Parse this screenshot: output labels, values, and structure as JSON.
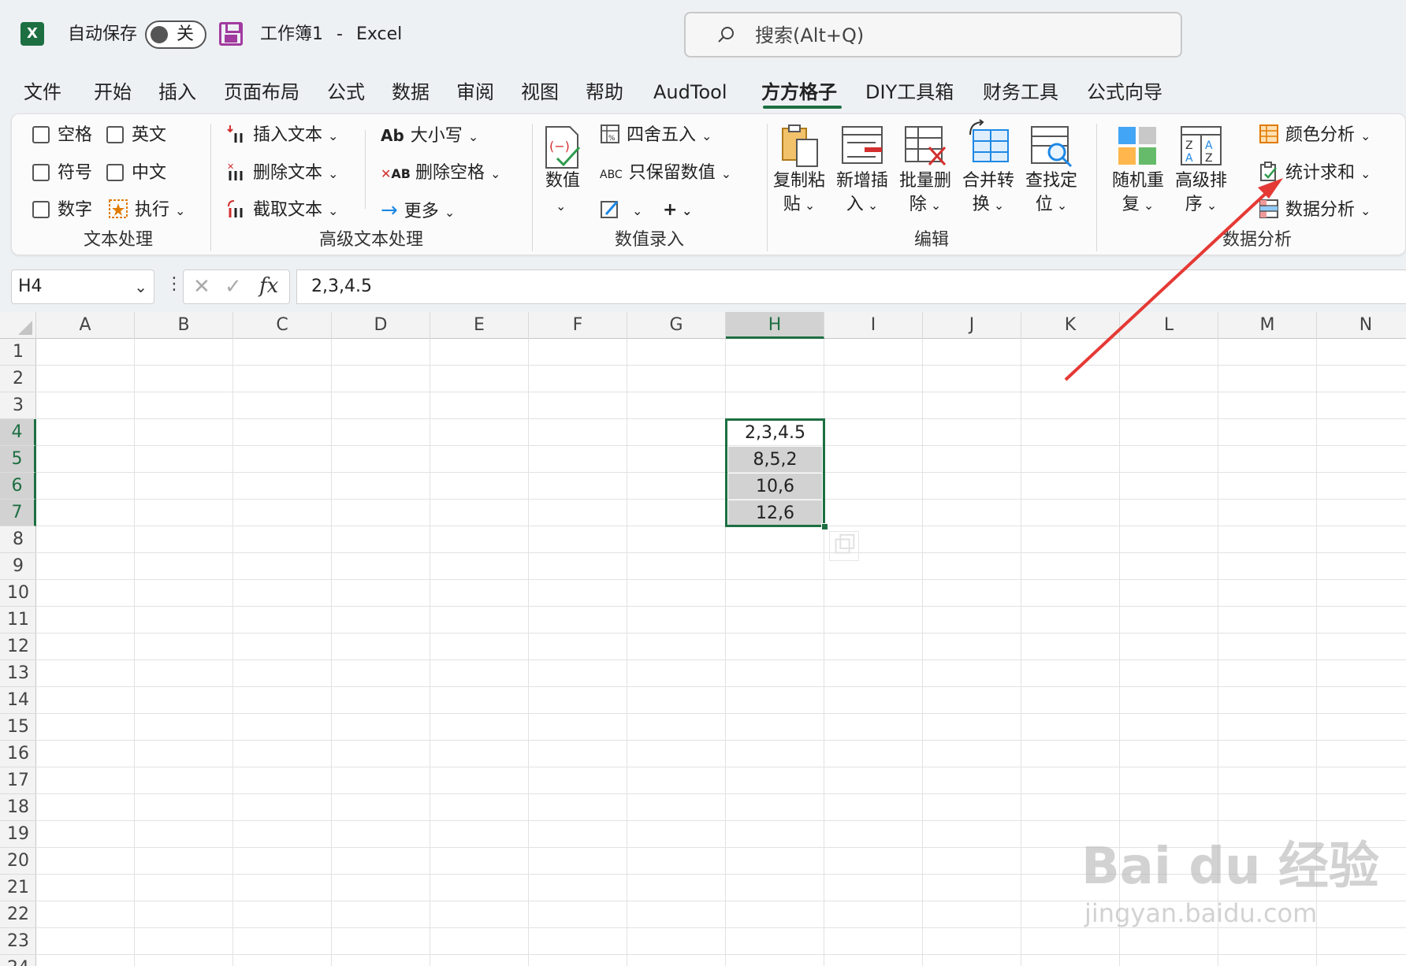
{
  "titlebar": {
    "app_logo": "X",
    "autosave_label": "自动保存",
    "autosave_state": "关",
    "doc_name": "工作簿1",
    "separator": "-",
    "app_name": "Excel",
    "search_placeholder": "搜索(Alt+Q)"
  },
  "menu": {
    "items": [
      "文件",
      "开始",
      "插入",
      "页面布局",
      "公式",
      "数据",
      "审阅",
      "视图",
      "帮助",
      "AudTool",
      "方方格子",
      "DIY工具箱",
      "财务工具",
      "公式向导"
    ],
    "active": "方方格子"
  },
  "ribbon": {
    "text_group": {
      "checkboxes": [
        "空格",
        "英文",
        "符号",
        "中文",
        "数字"
      ],
      "execute": "执行",
      "label": "文本处理"
    },
    "advanced_group": {
      "insert_text": "插入文本",
      "delete_text": "删除文本",
      "extract_text": "截取文本",
      "case": "大小写",
      "case_icon_text": "Ab",
      "delete_spaces": "删除空格",
      "delete_spaces_icon_text": "AB",
      "more": "更多",
      "label": "高级文本处理"
    },
    "number_group": {
      "value": "数值",
      "round": "四舍五入",
      "keep_values": "只保留数值",
      "keep_values_icon_text": "ABC",
      "plus": "+",
      "label": "数值录入"
    },
    "edit_group": {
      "buttons": [
        [
          "复制粘",
          "贴"
        ],
        [
          "新增插",
          "入"
        ],
        [
          "批量删",
          "除"
        ],
        [
          "合并转",
          "换"
        ],
        [
          "查找定",
          "位"
        ]
      ],
      "label": "编辑"
    },
    "analysis_group": {
      "random_repeat": [
        "随机重",
        "复"
      ],
      "advanced_sort": [
        "高级排",
        "序"
      ],
      "color_analysis": "颜色分析",
      "stat_sum": "统计求和",
      "data_analysis": "数据分析",
      "label": "数据分析"
    }
  },
  "formula_bar": {
    "cell_ref": "H4",
    "cancel": "✕",
    "enter": "✓",
    "fx": "fx",
    "value": "2,3,4.5"
  },
  "grid": {
    "columns": [
      "A",
      "B",
      "C",
      "D",
      "E",
      "F",
      "G",
      "H",
      "I",
      "J",
      "K",
      "L",
      "M",
      "N"
    ],
    "rows": [
      "1",
      "2",
      "3",
      "4",
      "5",
      "6",
      "7",
      "8",
      "9",
      "10",
      "11",
      "12",
      "13",
      "14",
      "15",
      "16",
      "17",
      "18",
      "19",
      "20",
      "21",
      "22",
      "23",
      "24"
    ],
    "selected_column": "H",
    "selected_rows": [
      "4",
      "5",
      "6",
      "7"
    ],
    "cells": {
      "H4": "2,3,4.5",
      "H5": "8,5,2",
      "H6": "10,6",
      "H7": "12,6"
    }
  },
  "watermark": {
    "brand": "Bai du 经验",
    "url": "jingyan.baidu.com"
  },
  "colors": {
    "excel_green": "#1d6f42",
    "arrow_red": "#e53935",
    "save_purple": "#a13b9f"
  }
}
